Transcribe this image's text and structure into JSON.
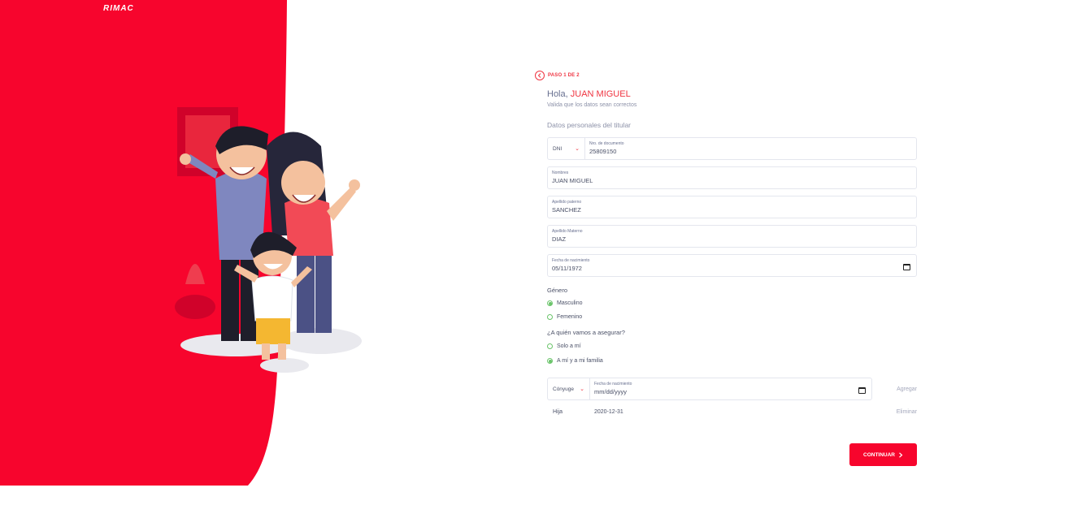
{
  "brand": {
    "logo_text": "RIMAC",
    "primary_color": "#f7052d"
  },
  "step": {
    "label": "PASO 1 DE 2",
    "back_icon": "chevron-left-icon"
  },
  "greeting": {
    "prefix": "Hola, ",
    "name": "JUAN MIGUEL",
    "subtitle": "Valida que los datos sean correctos"
  },
  "section_title": "Datos personales del titular",
  "document": {
    "type": "DNI",
    "number_label": "Nro. de documento",
    "number_value": "25809150"
  },
  "fields": [
    {
      "label": "Nombres",
      "value": "JUAN MIGUEL"
    },
    {
      "label": "Apellido paterno",
      "value": "SANCHEZ"
    },
    {
      "label": "Apellido Materno",
      "value": "DIAZ"
    },
    {
      "label": "Fecha de nacimiento",
      "value": "05/11/1972"
    }
  ],
  "gender": {
    "label": "Género",
    "options": [
      {
        "label": "Masculino",
        "selected": true
      },
      {
        "label": "Femenino",
        "selected": false
      }
    ]
  },
  "insure": {
    "label": "¿A quién vamos a asegurar?",
    "options": [
      {
        "label": "Solo a mí",
        "selected": false
      },
      {
        "label": "A mí y a mi familia",
        "selected": true
      }
    ]
  },
  "family_add": {
    "relation": "Cónyuge",
    "dob_label": "Fecha de nacimiento",
    "dob_placeholder": "mm/dd/yyyy",
    "add_label": "Agregar"
  },
  "members": [
    {
      "relation": "Hija",
      "date": "2020-12-31",
      "remove_label": "Eliminar"
    }
  ],
  "continue_label": "CONTINUAR"
}
